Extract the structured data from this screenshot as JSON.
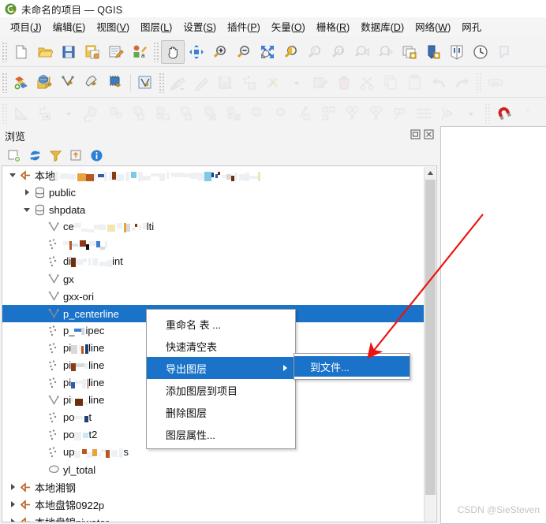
{
  "window": {
    "title": "未命名的项目 — QGIS",
    "logo_icon": "qgis-logo-icon"
  },
  "menubar": {
    "items": [
      {
        "label": "项目",
        "mnemonic": "J"
      },
      {
        "label": "编辑",
        "mnemonic": "E"
      },
      {
        "label": "视图",
        "mnemonic": "V"
      },
      {
        "label": "图层",
        "mnemonic": "L"
      },
      {
        "label": "设置",
        "mnemonic": "S"
      },
      {
        "label": "插件",
        "mnemonic": "P"
      },
      {
        "label": "矢量",
        "mnemonic": "O"
      },
      {
        "label": "栅格",
        "mnemonic": "R"
      },
      {
        "label": "数据库",
        "mnemonic": "D"
      },
      {
        "label": "网络",
        "mnemonic": "W"
      },
      {
        "label": "网孔",
        "mnemonic": ""
      }
    ]
  },
  "toolbars": {
    "row1": [
      "new-project-icon",
      "open-project-icon",
      "save-project-icon",
      "save-project-as-icon",
      "new-print-layout-icon",
      "style-manager-icon",
      "pan-map-icon",
      "pan-to-selection-icon",
      "zoom-in-icon",
      "zoom-out-icon",
      "zoom-full-icon",
      "zoom-selection-icon",
      "zoom-layer-icon",
      "zoom-native-icon",
      "zoom-last-icon",
      "zoom-next-icon",
      "refresh-icon",
      "new-map-view-icon",
      "new-3d-map-view-icon",
      "temporal-controller-icon"
    ],
    "row2": [
      "add-vector-layer-icon",
      "add-raster-layer-icon",
      "add-mesh-layer-icon",
      "add-delimited-text-layer-icon",
      "add-postgis-layer-icon",
      "add-virtual-layer-icon",
      "current-edits-icon",
      "toggle-editing-icon",
      "save-layer-edits-icon",
      "add-feature-icon",
      "vertex-tool-icon",
      "modify-attributes-icon",
      "delete-selected-icon",
      "cut-features-icon",
      "copy-features-icon",
      "paste-features-icon",
      "undo-icon",
      "redo-icon",
      "label-icon"
    ],
    "row3": [
      "measure-line-icon",
      "select-features-icon",
      "rotate-feature-icon",
      "move-feature-icon",
      "fill-ring-icon",
      "add-part-icon",
      "add-ring-icon",
      "delete-ring-icon",
      "delete-part-icon",
      "reshape-features-icon",
      "simplify-feature-icon",
      "offset-curve-icon",
      "split-features-icon",
      "split-parts-icon",
      "merge-features-icon",
      "merge-attributes-icon",
      "rotate-point-symbols-icon",
      "trim-extend-icon",
      "snapping-magnet-icon"
    ]
  },
  "panel": {
    "title": "浏览",
    "toolbar_icons": [
      "add-selected-layers-icon",
      "refresh-icon",
      "filter-browser-icon",
      "collapse-all-icon",
      "properties-info-icon"
    ],
    "window_buttons": [
      "undock-icon",
      "close-icon"
    ]
  },
  "tree": {
    "rows": [
      {
        "indent": 1,
        "twisty": "down",
        "icon": "postgres-connection-icon",
        "label": "本地",
        "redacted": true,
        "redact_width": 260
      },
      {
        "indent": 2,
        "twisty": "right",
        "icon": "schema-icon",
        "label": "public",
        "redacted": false
      },
      {
        "indent": 2,
        "twisty": "down",
        "icon": "schema-icon",
        "label": "shpdata",
        "redacted": false
      },
      {
        "indent": 3,
        "twisty": "none",
        "icon": "line-layer-icon",
        "label": "ce",
        "label_tail": "lti",
        "redacted": true,
        "redact_width": 92
      },
      {
        "indent": 3,
        "twisty": "none",
        "icon": "point-layer-icon",
        "label": "",
        "label_tail": "",
        "redacted": true,
        "redact_width": 56
      },
      {
        "indent": 3,
        "twisty": "none",
        "icon": "point-layer-icon",
        "label": "di",
        "label_tail": "int",
        "redacted": true,
        "redact_width": 52
      },
      {
        "indent": 3,
        "twisty": "none",
        "icon": "line-layer-icon",
        "label": "gx",
        "redacted": false
      },
      {
        "indent": 3,
        "twisty": "none",
        "icon": "line-layer-icon",
        "label": "gxx-ori",
        "redacted": false
      },
      {
        "indent": 3,
        "twisty": "none",
        "icon": "line-layer-icon",
        "label": "p_centerline",
        "redacted": false,
        "selected": true
      },
      {
        "indent": 3,
        "twisty": "none",
        "icon": "point-layer-icon",
        "label": "p_",
        "label_tail": "ipec",
        "redacted": true,
        "redact_width": 14
      },
      {
        "indent": 3,
        "twisty": "none",
        "icon": "point-layer-icon",
        "label": "pi",
        "label_tail": "line",
        "redacted": true,
        "redact_width": 22
      },
      {
        "indent": 3,
        "twisty": "none",
        "icon": "point-layer-icon",
        "label": "pi",
        "label_tail": "line",
        "redacted": true,
        "redact_width": 22
      },
      {
        "indent": 3,
        "twisty": "none",
        "icon": "point-layer-icon",
        "label": "pi",
        "label_tail": "line",
        "redacted": true,
        "redact_width": 22
      },
      {
        "indent": 3,
        "twisty": "none",
        "icon": "line-layer-icon",
        "label": "pi",
        "label_tail": "line",
        "redacted": true,
        "redact_width": 22
      },
      {
        "indent": 3,
        "twisty": "none",
        "icon": "point-layer-icon",
        "label": "po",
        "label_tail": "t",
        "redacted": true,
        "redact_width": 18
      },
      {
        "indent": 3,
        "twisty": "none",
        "icon": "point-layer-icon",
        "label": "po",
        "label_tail": "t2",
        "redacted": true,
        "redact_width": 18
      },
      {
        "indent": 3,
        "twisty": "none",
        "icon": "point-layer-icon",
        "label": "up",
        "label_tail": "s",
        "redacted": true,
        "redact_width": 62
      },
      {
        "indent": 3,
        "twisty": "none",
        "icon": "polygon-layer-icon",
        "label": "yl_total",
        "redacted": false
      },
      {
        "indent": 1,
        "twisty": "right",
        "icon": "postgres-connection-icon",
        "label": "本地湘钢",
        "redacted": false
      },
      {
        "indent": 1,
        "twisty": "right",
        "icon": "postgres-connection-icon",
        "label": "本地盘锦0922p",
        "redacted": false
      },
      {
        "indent": 1,
        "twisty": "right",
        "icon": "postgres-connection-icon",
        "label": "本地盘锦pjwater",
        "redacted": false
      }
    ]
  },
  "context_menu": {
    "items": [
      {
        "label": "重命名 表 ...",
        "highlighted": false,
        "submenu": false
      },
      {
        "label": "快速清空表",
        "highlighted": false,
        "submenu": false
      },
      {
        "label": "导出图层",
        "highlighted": true,
        "submenu": true
      },
      {
        "label": "添加图层到项目",
        "highlighted": false,
        "submenu": false
      },
      {
        "label": "删除图层",
        "highlighted": false,
        "submenu": false
      },
      {
        "label": "图层属性...",
        "highlighted": false,
        "submenu": false
      }
    ]
  },
  "submenu": {
    "items": [
      {
        "label": "到文件...",
        "highlighted": true
      }
    ]
  },
  "annotation": {
    "arrow_color": "#ee1111",
    "arrow_name": "red-pointer-arrow"
  },
  "watermark": {
    "text": "CSDN @SieSteven"
  },
  "colors": {
    "selection_blue": "#1a73c8",
    "menu_highlight": "#1a73c8",
    "panel_bg": "#f3f3f3",
    "tree_bg": "#ffffff",
    "annotation_red": "#ee1111",
    "watermark_gray": "#c3c3c3"
  }
}
